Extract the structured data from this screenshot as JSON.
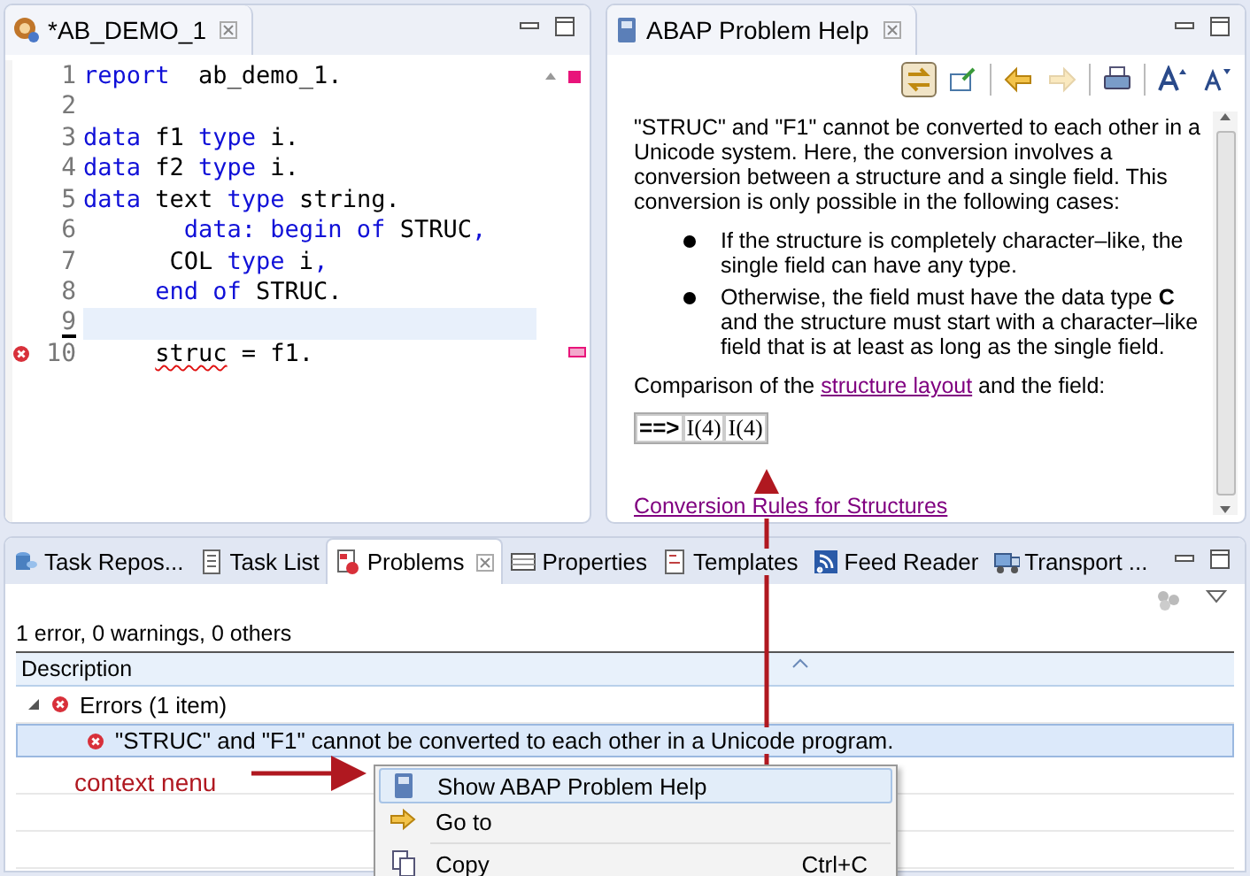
{
  "editor": {
    "tab_title": "*AB_DEMO_1",
    "lines": [
      {
        "number": "1",
        "current": false,
        "error": false,
        "tokens": [
          {
            "text": "report",
            "kind": "keyword"
          },
          {
            "text": "  ab_demo_1.",
            "kind": "plain"
          }
        ]
      },
      {
        "number": "2",
        "current": false,
        "error": false
      },
      {
        "number": "3",
        "current": false,
        "error": false,
        "tokens": [
          {
            "text": "data",
            "kind": "keyword"
          },
          {
            "text": " f1 ",
            "kind": "plain"
          },
          {
            "text": "type",
            "kind": "keyword"
          },
          {
            "text": " i.",
            "kind": "plain"
          }
        ]
      },
      {
        "number": "4",
        "current": false,
        "error": false,
        "tokens": [
          {
            "text": "data",
            "kind": "keyword"
          },
          {
            "text": " f2 ",
            "kind": "plain"
          },
          {
            "text": "type",
            "kind": "keyword"
          },
          {
            "text": " i.",
            "kind": "plain"
          }
        ]
      },
      {
        "number": "5",
        "current": false,
        "error": false,
        "tokens": [
          {
            "text": "data",
            "kind": "keyword"
          },
          {
            "text": " text ",
            "kind": "plain"
          },
          {
            "text": "type",
            "kind": "keyword"
          },
          {
            "text": " string.",
            "kind": "plain"
          }
        ]
      },
      {
        "number": "6",
        "current": false,
        "error": false,
        "tokens": [
          {
            "text": "       data: begin of",
            "kind": "keyword"
          },
          {
            "text": " STRUC",
            "kind": "plain"
          },
          {
            "text": ",",
            "kind": "keyword"
          }
        ]
      },
      {
        "number": "7",
        "current": false,
        "error": false,
        "tokens": [
          {
            "text": "      COL ",
            "kind": "plain"
          },
          {
            "text": "type",
            "kind": "keyword"
          },
          {
            "text": " i",
            "kind": "plain"
          },
          {
            "text": ",",
            "kind": "keyword"
          }
        ]
      },
      {
        "number": "8",
        "current": false,
        "error": false,
        "tokens": [
          {
            "text": "     end of",
            "kind": "keyword"
          },
          {
            "text": " STRUC.",
            "kind": "plain"
          }
        ]
      },
      {
        "number": "9",
        "current": true,
        "error": false
      },
      {
        "number": "10",
        "current": false,
        "error": true,
        "tokens": [
          {
            "text": "     struc",
            "kind": "error"
          },
          {
            "text": " = f1.",
            "kind": "plain"
          }
        ]
      }
    ]
  },
  "help": {
    "tab_title": "ABAP Problem Help",
    "toolbar": [
      {
        "kind": "sync",
        "pressed": true,
        "disabled": false
      },
      {
        "kind": "pin",
        "pressed": false,
        "disabled": false
      },
      {
        "kind": "separator"
      },
      {
        "kind": "back",
        "pressed": false,
        "disabled": false
      },
      {
        "kind": "forward",
        "pressed": false,
        "disabled": true
      },
      {
        "kind": "separator"
      },
      {
        "kind": "print",
        "pressed": false,
        "disabled": false
      },
      {
        "kind": "separator"
      },
      {
        "kind": "font-larger",
        "pressed": false,
        "disabled": false
      },
      {
        "kind": "font-smaller",
        "pressed": false,
        "disabled": false
      }
    ],
    "intro": "\"STRUC\" and \"F1\" cannot be converted to each other in a Unicode system. Here, the conversion involves a conversion between a structure and a single field. This conversion is only possible in the following cases:",
    "bullets": [
      "If the structure is completely character–like, the single field can have any type.",
      "Otherwise, the field must have the data type **C** and the structure must start with a character–like field that is at least as long as the single field."
    ],
    "comparison": {
      "before": "Comparison of the",
      "link": "structure layout",
      "after": "and the field:"
    },
    "layout_cells": [
      "==>",
      "I(4)",
      "I(4)"
    ],
    "footer_link": "Conversion Rules for Structures"
  },
  "problems_view": {
    "tabs": [
      {
        "label": "Task Repos...",
        "selected": false,
        "closable": false
      },
      {
        "label": "Task List",
        "selected": false,
        "closable": false
      },
      {
        "label": "Problems",
        "selected": true,
        "closable": true
      },
      {
        "label": "Properties",
        "selected": false,
        "closable": false
      },
      {
        "label": "Templates",
        "selected": false,
        "closable": false
      },
      {
        "label": "Feed Reader",
        "selected": false,
        "closable": false
      },
      {
        "label": "Transport ...",
        "selected": false,
        "closable": false
      }
    ],
    "summary": "1 error, 0 warnings, 0 others",
    "columns": [
      "Description"
    ],
    "tree": [
      {
        "label": "Errors (1 item)",
        "expanded": true,
        "selected": false,
        "children": [
          {
            "label": "\"STRUC\" and \"F1\" cannot be converted to each other in a Unicode program.",
            "selected": true
          }
        ]
      }
    ]
  },
  "context_menu": {
    "items": [
      {
        "label": "Show ABAP Problem Help",
        "selected": true
      },
      {
        "label": "Go to",
        "selected": false
      },
      {
        "label": "Copy",
        "shortcut": "Ctrl+C",
        "selected": false
      }
    ]
  },
  "annotation": {
    "label": "context nenu"
  }
}
